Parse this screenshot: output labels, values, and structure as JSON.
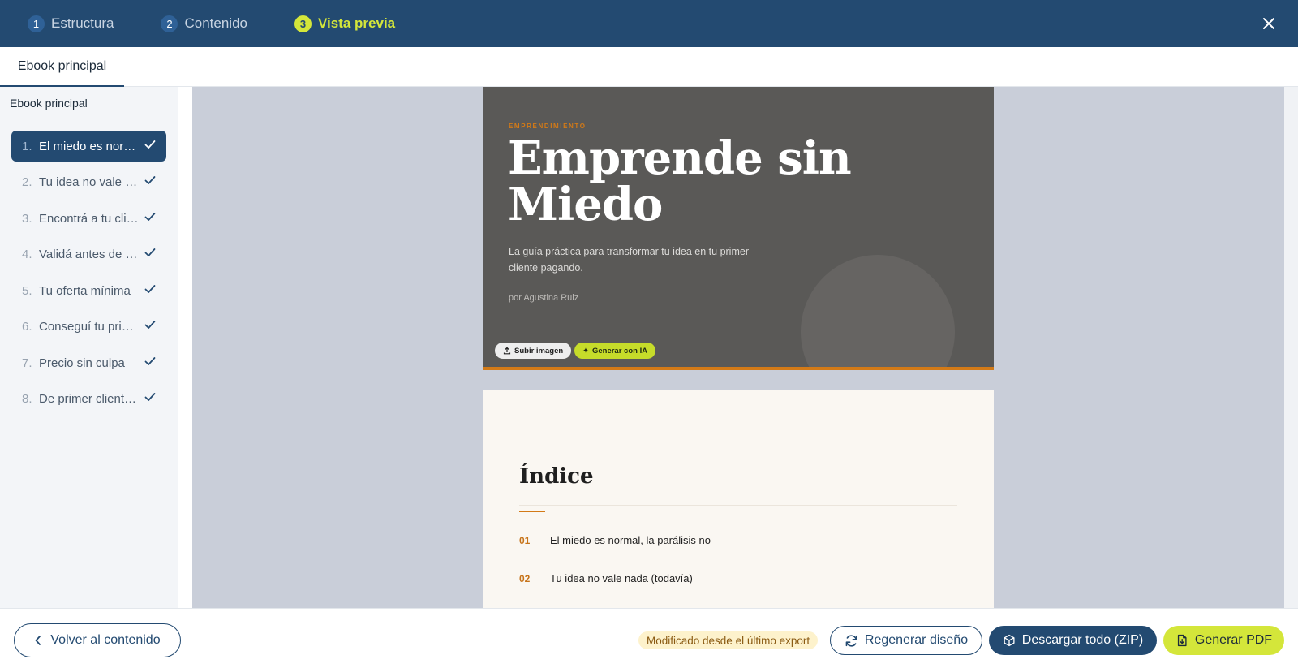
{
  "stepper": {
    "steps": [
      {
        "number": "1",
        "label": "Estructura"
      },
      {
        "number": "2",
        "label": "Contenido"
      },
      {
        "number": "3",
        "label": "Vista previa"
      }
    ],
    "active_step": 3,
    "close_icon": "close-icon"
  },
  "tabs": {
    "items": [
      {
        "label": "Ebook principal"
      }
    ]
  },
  "sidebar": {
    "title": "Ebook principal",
    "chapters": [
      {
        "number": "1.",
        "title": "El miedo es normal, la parálisis no",
        "done": true,
        "active": true
      },
      {
        "number": "2.",
        "title": "Tu idea no vale nada (todavía)",
        "done": true,
        "active": false
      },
      {
        "number": "3.",
        "title": "Encontrá a tu cliente",
        "done": true,
        "active": false
      },
      {
        "number": "4.",
        "title": "Validá antes de construir",
        "done": true,
        "active": false
      },
      {
        "number": "5.",
        "title": "Tu oferta mínima",
        "done": true,
        "active": false
      },
      {
        "number": "6.",
        "title": "Conseguí tu primer cliente",
        "done": true,
        "active": false
      },
      {
        "number": "7.",
        "title": "Precio sin culpa",
        "done": true,
        "active": false
      },
      {
        "number": "8.",
        "title": "De primer cliente a negocio",
        "done": true,
        "active": false
      }
    ]
  },
  "preview": {
    "cover": {
      "eyebrow": "EMPRENDIMIENTO",
      "title": "Emprende sin Miedo",
      "subtitle": "La guía práctica para transformar tu idea en tu primer cliente pagando.",
      "author": "por Agustina Ruiz",
      "upload_label": "Subir imagen",
      "ai_label": "Generar con IA",
      "accent_color": "#d37a17",
      "background_color": "#5a5957"
    },
    "index": {
      "title": "Índice",
      "entries": [
        {
          "number": "01",
          "title": "El miedo es normal, la parálisis no"
        },
        {
          "number": "02",
          "title": "Tu idea no vale nada (todavía)"
        }
      ]
    }
  },
  "footer": {
    "back_label": "Volver al contenido",
    "status": "Modificado desde el último export",
    "regenerate_label": "Regenerar diseño",
    "zip_label": "Descargar todo (ZIP)",
    "pdf_label": "Generar PDF"
  },
  "colors": {
    "primary": "#234a71",
    "accent_lime": "#d4e63a",
    "cover_accent": "#d37a17"
  }
}
